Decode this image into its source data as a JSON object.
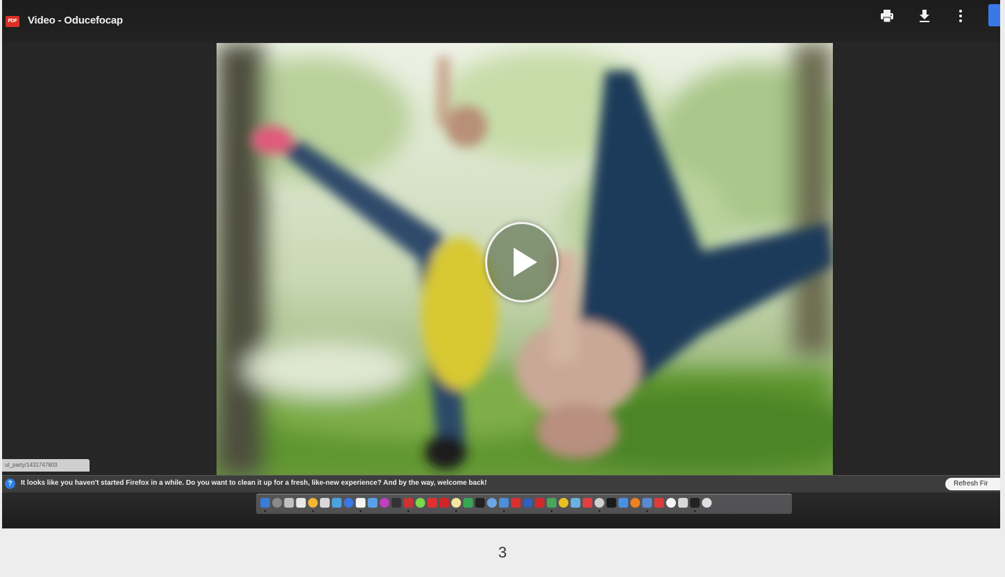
{
  "window": {
    "app_badge": "PDF",
    "title": "Video - Oducefocap"
  },
  "toolbar": {
    "icons": [
      "print-icon",
      "download-icon",
      "more-vertical-icon"
    ],
    "accent_color": "#3b78e7"
  },
  "player": {
    "play_icon": "play-icon"
  },
  "status_url": "ut_party/1431747803",
  "notification": {
    "icon": "info-icon",
    "message": "It looks like you haven't started Firefox in a while. Do you want to clean it up for a fresh, like-new experience? And by the way, welcome back!",
    "button_label": "Refresh Fir"
  },
  "dock": {
    "colors": [
      "#3a7bd5",
      "#8a8a8a",
      "#c0c0c0",
      "#e8e8e8",
      "#f2b632",
      "#d9d9d9",
      "#4aa3df",
      "#3b78e7",
      "#f5f5f5",
      "#5aa0e8",
      "#c040c0",
      "#333333",
      "#cc3333",
      "#7bd84a",
      "#e03030",
      "#d02525",
      "#f0e6a0",
      "#3aa655",
      "#222222",
      "#6aa6e8",
      "#4a8fd8",
      "#d83030",
      "#3060c0",
      "#d02a2a",
      "#49a55a",
      "#e8c020",
      "#6bb0e0",
      "#e04040",
      "#d0d0d0",
      "#1a1a1a",
      "#4a90e2",
      "#f08020",
      "#5a8ad0",
      "#e03b3b",
      "#f5f5f5",
      "#d8d8d8",
      "#222222",
      "#e0e0e0"
    ]
  },
  "page_number": "3"
}
